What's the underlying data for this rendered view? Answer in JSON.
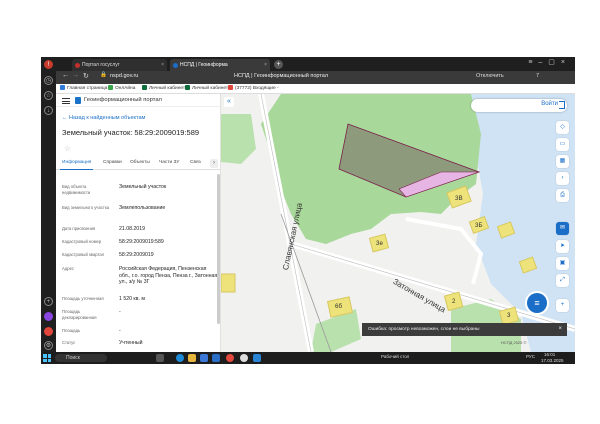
{
  "browser": {
    "tabs": [
      {
        "label": "Портал госуслуг",
        "active": false
      },
      {
        "label": "НСПД | Геоинформа",
        "active": true
      }
    ],
    "url": "nspd.gov.ru",
    "page_title": "НСПД | Геоинформационный портал",
    "right_labels": {
      "translate": "Отключить",
      "counter": "7"
    },
    "bookmarks": [
      "Главная страница",
      "ОнлАйна",
      "Личный кабинет",
      "Личный кабинет",
      "(37772) Входящие -"
    ]
  },
  "panel": {
    "portal_title": "Геоинформационный портал",
    "back_link": "Назад к найденным объектам",
    "object_title": "Земельный участок: 58:29:2009019:589",
    "tabs": [
      "Информация",
      "Справки",
      "Объекты",
      "Части ЗУ",
      "Связ"
    ],
    "rows": [
      {
        "k": "Вид объекта недвижимости",
        "v": "Земельный участок"
      },
      {
        "k": "Вид земельного участка",
        "v": "Землепользование"
      },
      {
        "k": "Дата присвоения",
        "v": "21.08.2019"
      },
      {
        "k": "Кадастровый номер",
        "v": "58:29:2009019:589"
      },
      {
        "k": "Кадастровый квартал",
        "v": "58:29:2009019"
      },
      {
        "k": "Адрес",
        "v": "Российская Федерация, Пензенская обл., г.о. город Пенза, Пенза г., Затонная ул., з/у № 3Г"
      },
      {
        "k": "Площадь уточненная",
        "v": "1 520 кв. м"
      },
      {
        "k": "Площадь декларированная",
        "v": "-"
      },
      {
        "k": "Площадь",
        "v": "-"
      },
      {
        "k": "Статус",
        "v": "Учтенный"
      }
    ]
  },
  "map": {
    "login_label": "Войти",
    "buildings": [
      "3В",
      "3Б",
      "3е",
      "6б",
      "2",
      "3"
    ],
    "streets": [
      "Славянская улица",
      "Затонная улица"
    ],
    "toast": "Ошибка: просмотр невозможен, слои не выбраны",
    "scale": "НСПД 2025 ©"
  },
  "taskbar": {
    "search": "Поиск",
    "desktop": "Рабочий стол",
    "lang": "РУС",
    "time": "16:01",
    "date": "17.03.2025"
  },
  "colors": {
    "accent": "#1a6ec7",
    "green": "#a8d89a",
    "parcel_fill": "#8e9a7c",
    "pink": "#e6b5e3"
  }
}
